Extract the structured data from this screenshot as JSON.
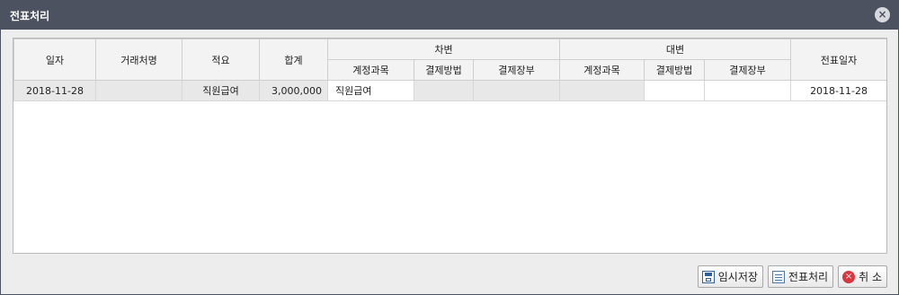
{
  "window": {
    "title": "전표처리"
  },
  "headers": {
    "date": "일자",
    "customer": "거래처명",
    "summary": "적요",
    "total": "합계",
    "debit": "차변",
    "credit": "대변",
    "account": "계정과목",
    "payment_method": "결제방법",
    "payment_account": "결제장부",
    "voucher_date": "전표일자"
  },
  "rows": [
    {
      "date": "2018-11-28",
      "customer": "",
      "summary": "직원급여",
      "total": "3,000,000",
      "debit_account": "직원급여",
      "debit_method": "",
      "debit_ledger": "",
      "credit_account": "",
      "credit_method": "",
      "credit_ledger": "",
      "voucher_date": "2018-11-28"
    }
  ],
  "buttons": {
    "temp_save": "임시저장",
    "process": "전표처리",
    "cancel": "취 소"
  }
}
